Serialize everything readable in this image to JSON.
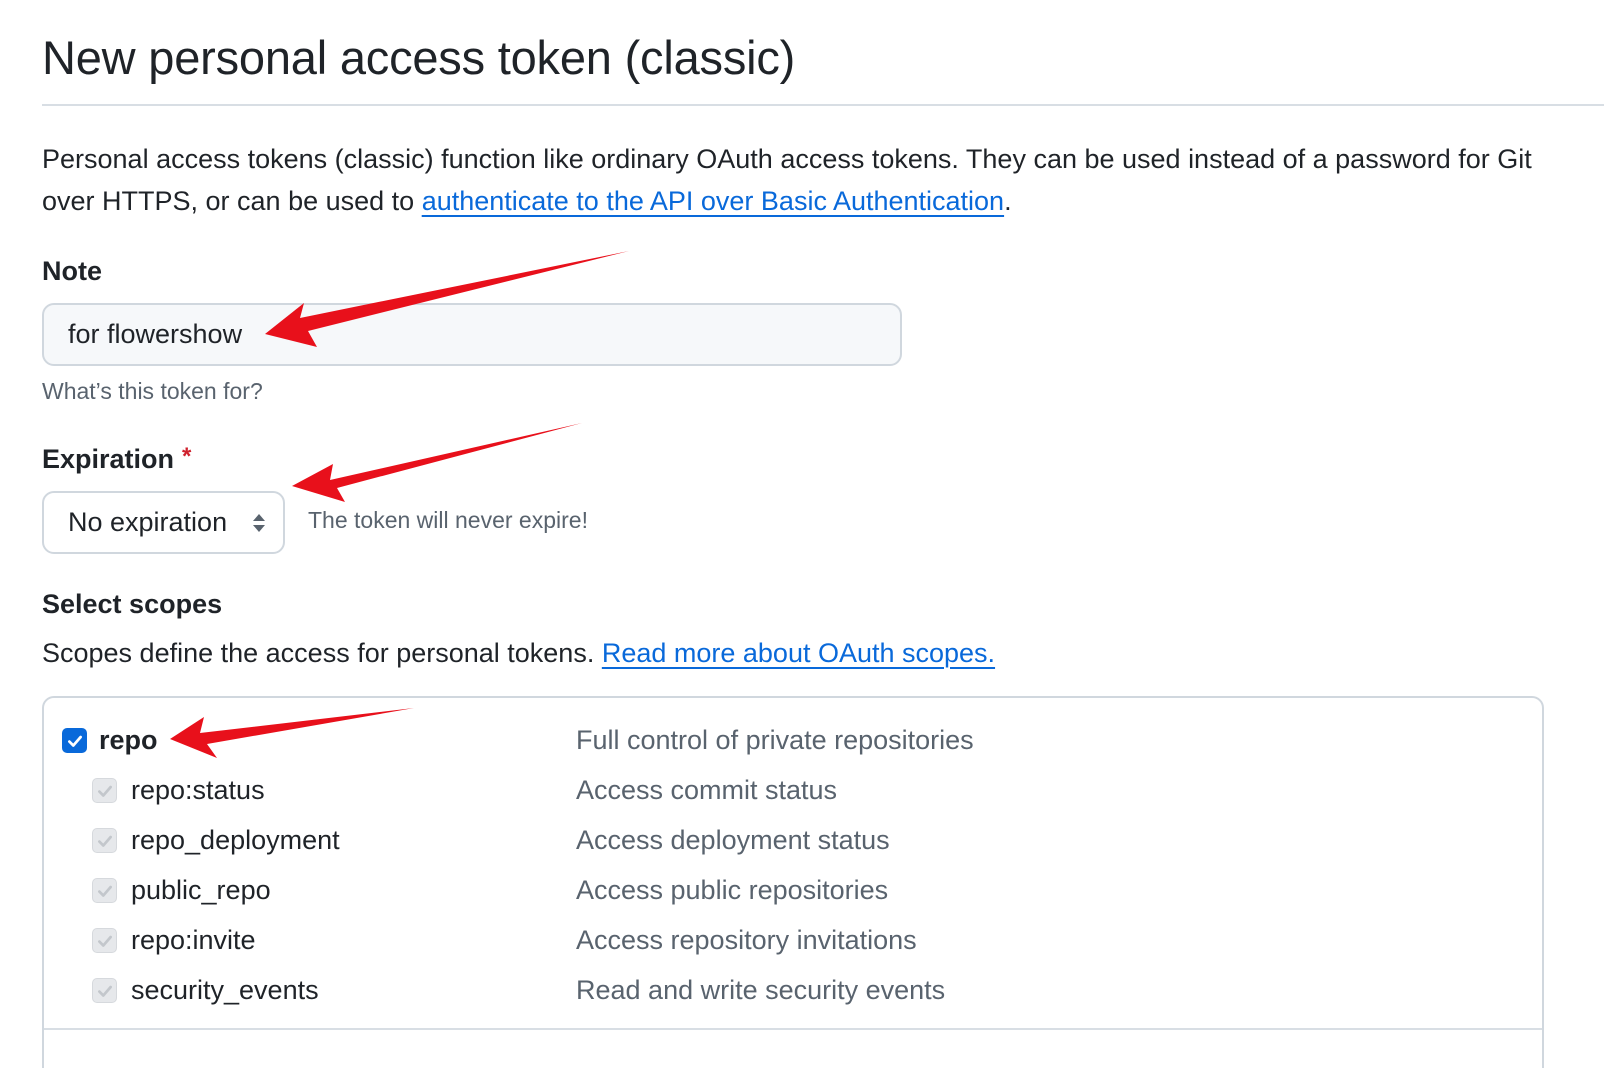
{
  "page": {
    "title": "New personal access token (classic)",
    "intro_text": "Personal access tokens (classic) function like ordinary OAuth access tokens. They can be used instead of a password for Git over HTTPS, or can be used to ",
    "intro_link": "authenticate to the API over Basic Authentication",
    "intro_end": "."
  },
  "note": {
    "label": "Note",
    "value": "for flowershow",
    "hint": "What’s this token for?"
  },
  "expiration": {
    "label": "Expiration",
    "required_mark": "*",
    "selected": "No expiration",
    "hint": "The token will never expire!"
  },
  "scopes": {
    "heading": "Select scopes",
    "description": "Scopes define the access for personal tokens. ",
    "link": "Read more about OAuth scopes.",
    "items": [
      {
        "name": "repo",
        "description": "Full control of private repositories",
        "checked": true,
        "child": false
      },
      {
        "name": "repo:status",
        "description": "Access commit status",
        "checked": true,
        "child": true
      },
      {
        "name": "repo_deployment",
        "description": "Access deployment status",
        "checked": true,
        "child": true
      },
      {
        "name": "public_repo",
        "description": "Access public repositories",
        "checked": true,
        "child": true
      },
      {
        "name": "repo:invite",
        "description": "Access repository invitations",
        "checked": true,
        "child": true
      },
      {
        "name": "security_events",
        "description": "Read and write security events",
        "checked": true,
        "child": true
      }
    ]
  },
  "colors": {
    "link": "#0969da",
    "annotation_arrow": "#e8101b",
    "required": "#cf222e",
    "checkbox_checked": "#0969da"
  },
  "icons": {
    "select_caret": "chevron-up-down-icon",
    "checkbox_check": "check-icon",
    "annotation": "red-arrow-icon"
  }
}
